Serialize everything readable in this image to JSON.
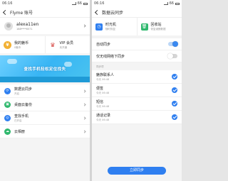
{
  "left": {
    "status": {
      "time": "06:16",
      "battery": "66"
    },
    "title": "Flyme 账号",
    "profile": {
      "name": "alexa11en",
      "phone": "188****6571"
    },
    "wallet": [
      {
        "label": "我的魅币",
        "sub": "0魅币",
        "icon": "coin-icon"
      },
      {
        "label": "VIP 会员",
        "sub": "未开通",
        "icon": "crown-icon"
      }
    ],
    "banner": {
      "text": "查找手机轻松定位找失"
    },
    "menu": [
      {
        "label": "数据云同步",
        "sub": "开启",
        "icon": "sync-icon",
        "color": "#2f7ff0"
      },
      {
        "label": "桌面云备份",
        "sub": "",
        "icon": "backup-icon",
        "color": "#2fb86d"
      },
      {
        "label": "查找手机",
        "sub": "已开启",
        "icon": "locate-icon",
        "color": "#2f7ff0"
      },
      {
        "label": "云相册",
        "sub": "",
        "icon": "album-icon",
        "color": "#2fb86d"
      }
    ]
  },
  "right": {
    "status": {
      "time": "06:16",
      "battery": "66"
    },
    "title": "数据云同步",
    "tiles": [
      {
        "label": "时光机",
        "sub": "随时恢复",
        "icon": "clock-icon",
        "color": "#2f7ff0"
      },
      {
        "label": "回收站",
        "sub": "恢复误删数据",
        "icon": "trash-icon",
        "color": "#2fb86d"
      }
    ],
    "settings": [
      {
        "label": "自动同步",
        "state": "on"
      },
      {
        "label": "仅无线网络下同步",
        "state": "off"
      }
    ],
    "section": "同步项",
    "items": [
      {
        "label": "魅族联系人",
        "sub": "今天 06:48"
      },
      {
        "label": "便签",
        "sub": "今天 06:48"
      },
      {
        "label": "短信",
        "sub": "今天 06:48"
      },
      {
        "label": "通话记录",
        "sub": "今天 06:48"
      }
    ],
    "button": "立即同步"
  }
}
